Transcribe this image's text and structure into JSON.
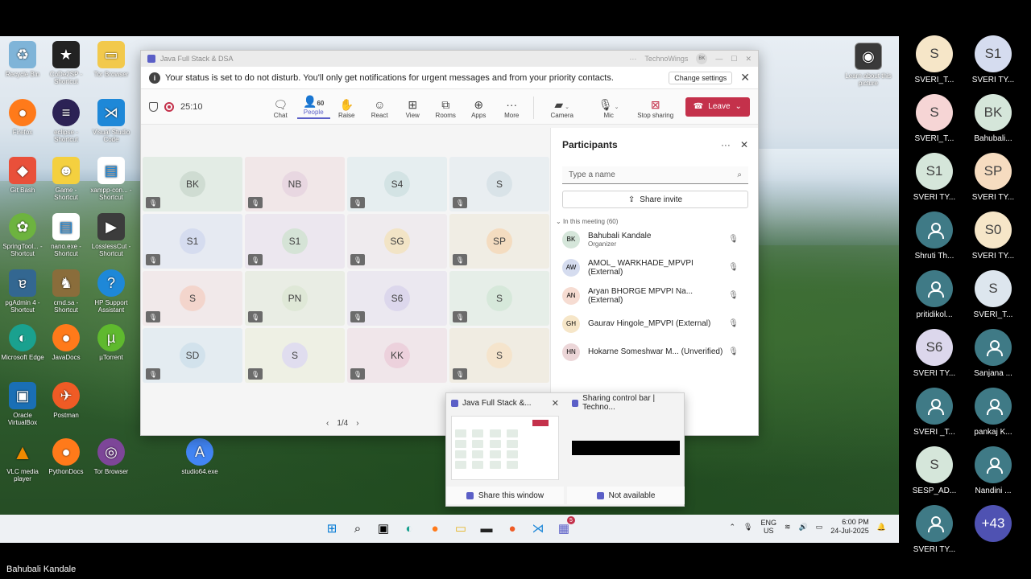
{
  "teams": {
    "window_title": "Java Full Stack & DSA",
    "org_name": "TechnoWings",
    "org_initials": "BK",
    "banner_text": "Your status is set to do not disturb. You'll only get notifications for urgent messages and from your priority contacts.",
    "banner_button": "Change settings",
    "timer": "25:10",
    "people_count": "60",
    "tools": {
      "chat": "Chat",
      "people": "People",
      "raise": "Raise",
      "react": "React",
      "view": "View",
      "rooms": "Rooms",
      "apps": "Apps",
      "more": "More",
      "camera": "Camera",
      "mic": "Mic",
      "stop_sharing": "Stop sharing"
    },
    "leave_label": "Leave",
    "pager": "1/4"
  },
  "grid": [
    {
      "initials": "BK",
      "bg": "#e3ece5",
      "av": "#cfdcd2"
    },
    {
      "initials": "NB",
      "bg": "#f1e7e8",
      "av": "#e8d7e1"
    },
    {
      "initials": "S4",
      "bg": "#e6eef0",
      "av": "#d3e3e4"
    },
    {
      "initials": "S",
      "bg": "#e9eef1",
      "av": "#d9e3e8"
    },
    {
      "initials": "S1",
      "bg": "#e6eaf2",
      "av": "#d5dcef"
    },
    {
      "initials": "S1",
      "bg": "#ece7ef",
      "av": "#d5e3d6"
    },
    {
      "initials": "SG",
      "bg": "#efebee",
      "av": "#f2e4c6"
    },
    {
      "initials": "SP",
      "bg": "#f0ede4",
      "av": "#f4dcc0"
    },
    {
      "initials": "S",
      "bg": "#f1e9ea",
      "av": "#f3d5cc"
    },
    {
      "initials": "PN",
      "bg": "#e9ede4",
      "av": "#dfe8d7"
    },
    {
      "initials": "S6",
      "bg": "#ebe8f0",
      "av": "#dcd7ec"
    },
    {
      "initials": "S",
      "bg": "#e6eee8",
      "av": "#d6e8da"
    },
    {
      "initials": "SD",
      "bg": "#e4ecf1",
      "av": "#d2e2ec"
    },
    {
      "initials": "S",
      "bg": "#eef0e4",
      "av": "#e0ddef"
    },
    {
      "initials": "KK",
      "bg": "#f0e6ea",
      "av": "#ecd1dc"
    },
    {
      "initials": "S",
      "bg": "#f0ece2",
      "av": "#f5e4cc"
    }
  ],
  "panel": {
    "title": "Participants",
    "search_placeholder": "Type a name",
    "invite_label": "Share invite",
    "section": "In this meeting (60)",
    "people": [
      {
        "initials": "BK",
        "name": "Bahubali Kandale",
        "role": "Organizer",
        "color": "#d5e6da"
      },
      {
        "initials": "AW",
        "name": "AMOL_ WARKHADE_MPVPI (External)",
        "role": "",
        "color": "#d5dcef"
      },
      {
        "initials": "AN",
        "name": "Aryan BHORGE MPVPI Na... (External)",
        "role": "",
        "color": "#f6dcd2"
      },
      {
        "initials": "GH",
        "name": "Gaurav Hingole_MPVPI (External)",
        "role": "",
        "color": "#f6e6c8"
      },
      {
        "initials": "HN",
        "name": "Hokarne Someshwar M... (Unverified)",
        "role": "",
        "color": "#ecd6d8"
      }
    ]
  },
  "share": {
    "window_title": "Java Full Stack &...",
    "window_action": "Share this window",
    "bar_title": "Sharing control bar | Techno...",
    "bar_action": "Not available"
  },
  "desktop_icons": [
    "Recycle Bin",
    "CoDe2SP - Shortcut",
    "Tor Browser",
    "Firefox",
    "eclipse - Shortcut",
    "Visual Studio Code",
    "Git Bash",
    "Game - Shortcut",
    "xampp-con... - Shortcut",
    "SpringTool... - Shortcut",
    "nano.exe - Shortcut",
    "LosslessCut - Shortcut",
    "pgAdmin 4 - Shortcut",
    "cmd.sa - Shortcut",
    "HP Support Assistant",
    "Microsoft Edge",
    "JavaDocs",
    "µTorrent",
    "Oracle VirtualBox",
    "Postman",
    "VLC media player",
    "PythonDocs",
    "Tor Browser",
    "studio64.exe",
    "Learn about this picture"
  ],
  "taskbar": {
    "teams_badge": "5",
    "lang_top": "ENG",
    "lang_bottom": "US",
    "time": "6:00 PM",
    "date": "24-Jul-2025"
  },
  "gallery": [
    {
      "initials": "S",
      "name": "SVERI_T...",
      "color": "#f6e6c8"
    },
    {
      "initials": "S1",
      "name": "SVERI TY...",
      "color": "#d5dcef"
    },
    {
      "initials": "S",
      "name": "SVERI_T...",
      "color": "#f6d5d5"
    },
    {
      "initials": "BK",
      "name": "Bahubali...",
      "color": "#d5e6da"
    },
    {
      "initials": "S1",
      "name": "SVERI TY...",
      "color": "#d5e6da"
    },
    {
      "initials": "SP",
      "name": "SVERI TY...",
      "color": "#f6dcc0"
    },
    {
      "initials": "",
      "name": "Shruti Th...",
      "color": "#3f7a86"
    },
    {
      "initials": "S0",
      "name": "SVERI TY...",
      "color": "#f6e6c8"
    },
    {
      "initials": "",
      "name": "pritidikol...",
      "color": "#3f7a86"
    },
    {
      "initials": "S",
      "name": "SVERI_T...",
      "color": "#dde6ee"
    },
    {
      "initials": "S6",
      "name": "SVERI TY...",
      "color": "#dcd7ec"
    },
    {
      "initials": "",
      "name": "Sanjana ...",
      "color": "#3f7a86"
    },
    {
      "initials": "",
      "name": "SVERI _T...",
      "color": "#3f7a86"
    },
    {
      "initials": "",
      "name": "pankaj K...",
      "color": "#3f7a86"
    },
    {
      "initials": "S",
      "name": "SESP_AD...",
      "color": "#d5e6da"
    },
    {
      "initials": "",
      "name": "Nandini ...",
      "color": "#3f7a86"
    },
    {
      "initials": "",
      "name": "SVERI TY...",
      "color": "#3f7a86"
    },
    {
      "initials": "+43",
      "name": "",
      "color": "#4f52b2"
    }
  ],
  "presenter_name": "Bahubali Kandale"
}
